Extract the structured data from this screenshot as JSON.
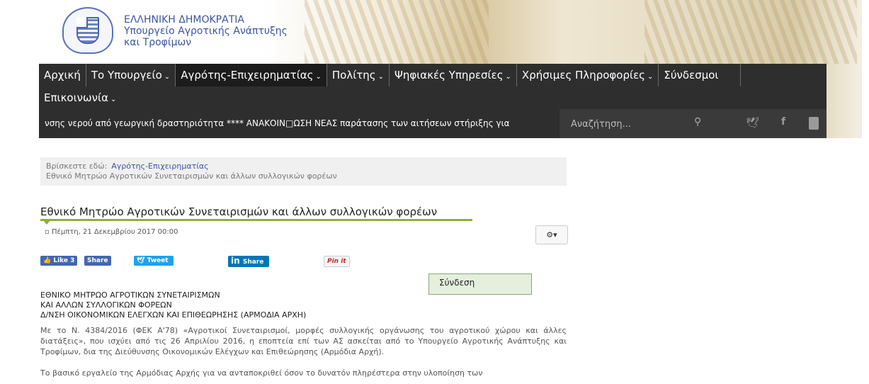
{
  "header": {
    "logo_icon": "greek-coat-of-arms-icon",
    "brand_lines": [
      "ΕΛΛΗΝΙΚΗ ΔΗΜΟΚΡΑΤΙΑ",
      "Υπουργείο Αγροτικής Ανάπτυξης",
      "και Τροφίμων"
    ]
  },
  "nav": {
    "items": [
      "Αρχική",
      "Το Υπουργείο",
      "Αγρότης-Επιχειρηματίας",
      "Πολίτης",
      "Ψηφιακές Υπηρεσίες",
      "Χρήσιμες Πληροφορίες",
      "Σύνδεσμοι"
    ],
    "row2_item": "Επικοινωνία",
    "chevron": "⌄"
  },
  "ticker": "νσης νερού από γεωργική δραστηριότητα ****  ΑΝΑΚΟΙΝ□ΩΣΗ ΝΕΑΣ παράτασης των αιτήσεων στήριξης για",
  "search": {
    "placeholder": "Αναζήτηση...",
    "icon": "search-icon"
  },
  "social_header": {
    "twitter_icon": "twitter-icon",
    "facebook_icon": "facebook-icon",
    "youtube_icon": "youtube-icon"
  },
  "breadcrumb": {
    "prefix": "Βρίσκεστε εδώ:",
    "link": "Αγρότης-Επιχειρηματίας",
    "current": "Εθνικό Μητρώο Αγροτικών Συνεταιρισμών και άλλων συλλογικών φορέων"
  },
  "article": {
    "title": "Εθνικό Μητρώο Αγροτικών Συνεταιρισμών και άλλων συλλογικών φορέων",
    "date": "Πέμπτη, 21 Δεκεμβρίου 2017 00:00",
    "heading_lines": [
      "ΕΘΝΙΚΟ ΜΗΤΡΩΟ ΑΓΡΟΤΙΚΩΝ ΣΥΝΕΤΑΙΡΙΣΜΩΝ",
      "ΚΑΙ ΑΛΛΩΝ ΣΥΛΛΟΓΙΚΩΝ ΦΟΡΕΩΝ",
      "Δ/ΝΣΗ ΟΙΚΟΝΟΜΙΚΩΝ ΕΛΕΓΧΩΝ ΚΑΙ ΕΠΙΘΕΩΡΗΣΗΣ (ΑΡΜΟΔΙΑ ΑΡΧΗ)"
    ],
    "para1": "Με το Ν. 4384/2016 (ΦΕΚ Α'78) «Αγροτικοί Συνεταιρισμοί, μορφές συλλογικής οργάνωσης του αγροτικού χώρου και άλλες διατάξεις», που ισχύει από τις 26 Απριλίου 2016, η εποπτεία επί των ΑΣ ασκείται από το Υπουργείο Αγροτικής Ανάπτυξης και Τροφίμων, δια της Διεύθυνσης Οικονομικών Ελέγχων και Επιθεώρησης (Αρμόδια Αρχή).",
    "para2": "Το βασικό εργαλείο της Αρμόδιας Αρχής για να ανταποκριθεί όσον το δυνατόν πληρέστερα στην υλοποίηση των"
  },
  "share": {
    "like": "Like 3",
    "share": "Share",
    "tweet": "Tweet",
    "linkedin": "Share",
    "pin": "Pin it"
  },
  "login_label": "Σύνδεση",
  "colors": {
    "nav_bg": "#2e2e2e",
    "accent_green": "#8fb03b",
    "brand_blue": "#3b55a4"
  }
}
